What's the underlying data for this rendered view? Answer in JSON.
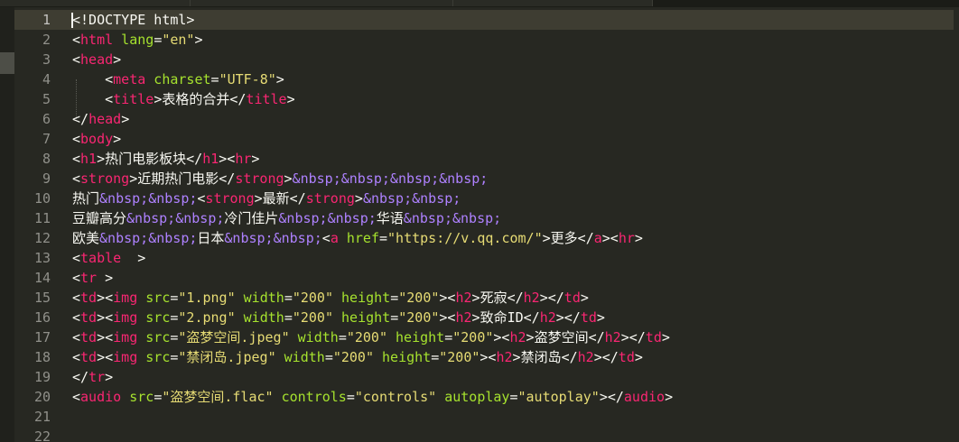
{
  "colors": {
    "background": "#272822",
    "tag": "#f92672",
    "attribute": "#a6e22e",
    "string": "#e6db74",
    "entity": "#ae81ff",
    "text": "#f8f8f2",
    "line_number": "#90908a",
    "current_line": "#3e3d32"
  },
  "editor": {
    "current_line": 1,
    "lines": [
      {
        "n": "1",
        "tokens": [
          [
            "t",
            "<!DOCTYPE html>"
          ]
        ]
      },
      {
        "n": "2",
        "tokens": [
          [
            "p",
            "<"
          ],
          [
            "g",
            "html"
          ],
          [
            "a",
            " lang"
          ],
          [
            "p",
            "="
          ],
          [
            "s",
            "\"en\""
          ],
          [
            "p",
            ">"
          ]
        ]
      },
      {
        "n": "3",
        "tokens": [
          [
            "p",
            "<"
          ],
          [
            "g",
            "head"
          ],
          [
            "p",
            ">"
          ]
        ]
      },
      {
        "n": "4",
        "tokens": [
          [
            "t",
            "    "
          ],
          [
            "p",
            "<"
          ],
          [
            "g",
            "meta"
          ],
          [
            "a",
            " charset"
          ],
          [
            "p",
            "="
          ],
          [
            "s",
            "\"UTF-8\""
          ],
          [
            "p",
            ">"
          ]
        ]
      },
      {
        "n": "5",
        "tokens": [
          [
            "t",
            "    "
          ],
          [
            "p",
            "<"
          ],
          [
            "g",
            "title"
          ],
          [
            "p",
            ">"
          ],
          [
            "t",
            "表格的合并"
          ],
          [
            "p",
            "</"
          ],
          [
            "g",
            "title"
          ],
          [
            "p",
            ">"
          ]
        ]
      },
      {
        "n": "6",
        "tokens": [
          [
            "p",
            "</"
          ],
          [
            "g",
            "head"
          ],
          [
            "p",
            ">"
          ]
        ]
      },
      {
        "n": "7",
        "tokens": [
          [
            "p",
            "<"
          ],
          [
            "g",
            "body"
          ],
          [
            "p",
            ">"
          ]
        ]
      },
      {
        "n": "8",
        "tokens": [
          [
            "p",
            "<"
          ],
          [
            "g",
            "h1"
          ],
          [
            "p",
            ">"
          ],
          [
            "t",
            "热门电影板块"
          ],
          [
            "p",
            "</"
          ],
          [
            "g",
            "h1"
          ],
          [
            "p",
            "><"
          ],
          [
            "g",
            "hr"
          ],
          [
            "p",
            ">"
          ]
        ]
      },
      {
        "n": "9",
        "tokens": [
          [
            "p",
            "<"
          ],
          [
            "g",
            "strong"
          ],
          [
            "p",
            ">"
          ],
          [
            "t",
            "近期热门电影"
          ],
          [
            "p",
            "</"
          ],
          [
            "g",
            "strong"
          ],
          [
            "p",
            ">"
          ],
          [
            "e",
            "&nbsp;&nbsp;&nbsp;&nbsp;"
          ]
        ]
      },
      {
        "n": "10",
        "tokens": [
          [
            "t",
            "热门"
          ],
          [
            "e",
            "&nbsp;&nbsp;"
          ],
          [
            "p",
            "<"
          ],
          [
            "g",
            "strong"
          ],
          [
            "p",
            ">"
          ],
          [
            "t",
            "最新"
          ],
          [
            "p",
            "</"
          ],
          [
            "g",
            "strong"
          ],
          [
            "p",
            ">"
          ],
          [
            "e",
            "&nbsp;&nbsp;"
          ]
        ]
      },
      {
        "n": "11",
        "tokens": [
          [
            "t",
            "豆瓣高分"
          ],
          [
            "e",
            "&nbsp;&nbsp;"
          ],
          [
            "t",
            "冷门佳片"
          ],
          [
            "e",
            "&nbsp;&nbsp;"
          ],
          [
            "t",
            "华语"
          ],
          [
            "e",
            "&nbsp;&nbsp;"
          ]
        ]
      },
      {
        "n": "12",
        "tokens": [
          [
            "t",
            "欧美"
          ],
          [
            "e",
            "&nbsp;&nbsp;"
          ],
          [
            "t",
            "日本"
          ],
          [
            "e",
            "&nbsp;&nbsp;"
          ],
          [
            "p",
            "<"
          ],
          [
            "g",
            "a"
          ],
          [
            "a",
            " href"
          ],
          [
            "p",
            "="
          ],
          [
            "s",
            "\"https://v.qq.com/\""
          ],
          [
            "p",
            ">"
          ],
          [
            "t",
            "更多"
          ],
          [
            "p",
            "</"
          ],
          [
            "g",
            "a"
          ],
          [
            "p",
            "><"
          ],
          [
            "g",
            "hr"
          ],
          [
            "p",
            ">"
          ]
        ]
      },
      {
        "n": "13",
        "tokens": [
          [
            "p",
            "<"
          ],
          [
            "g",
            "table"
          ],
          [
            "t",
            "  "
          ],
          [
            "p",
            ">"
          ]
        ]
      },
      {
        "n": "14",
        "tokens": [
          [
            "p",
            "<"
          ],
          [
            "g",
            "tr"
          ],
          [
            "t",
            " "
          ],
          [
            "p",
            ">"
          ]
        ]
      },
      {
        "n": "15",
        "tokens": [
          [
            "p",
            "<"
          ],
          [
            "g",
            "td"
          ],
          [
            "p",
            "><"
          ],
          [
            "g",
            "img"
          ],
          [
            "a",
            " src"
          ],
          [
            "p",
            "="
          ],
          [
            "s",
            "\"1.png\""
          ],
          [
            "a",
            " width"
          ],
          [
            "p",
            "="
          ],
          [
            "s",
            "\"200\""
          ],
          [
            "a",
            " height"
          ],
          [
            "p",
            "="
          ],
          [
            "s",
            "\"200\""
          ],
          [
            "p",
            "><"
          ],
          [
            "g",
            "h2"
          ],
          [
            "p",
            ">"
          ],
          [
            "t",
            "死寂"
          ],
          [
            "p",
            "</"
          ],
          [
            "g",
            "h2"
          ],
          [
            "p",
            "></"
          ],
          [
            "g",
            "td"
          ],
          [
            "p",
            ">"
          ]
        ]
      },
      {
        "n": "16",
        "tokens": [
          [
            "p",
            "<"
          ],
          [
            "g",
            "td"
          ],
          [
            "p",
            "><"
          ],
          [
            "g",
            "img"
          ],
          [
            "a",
            " src"
          ],
          [
            "p",
            "="
          ],
          [
            "s",
            "\"2.png\""
          ],
          [
            "a",
            " width"
          ],
          [
            "p",
            "="
          ],
          [
            "s",
            "\"200\""
          ],
          [
            "a",
            " height"
          ],
          [
            "p",
            "="
          ],
          [
            "s",
            "\"200\""
          ],
          [
            "p",
            "><"
          ],
          [
            "g",
            "h2"
          ],
          [
            "p",
            ">"
          ],
          [
            "t",
            "致命ID"
          ],
          [
            "p",
            "</"
          ],
          [
            "g",
            "h2"
          ],
          [
            "p",
            "></"
          ],
          [
            "g",
            "td"
          ],
          [
            "p",
            ">"
          ]
        ]
      },
      {
        "n": "17",
        "tokens": [
          [
            "p",
            "<"
          ],
          [
            "g",
            "td"
          ],
          [
            "p",
            "><"
          ],
          [
            "g",
            "img"
          ],
          [
            "a",
            " src"
          ],
          [
            "p",
            "="
          ],
          [
            "s",
            "\"盗梦空间.jpeg\""
          ],
          [
            "a",
            " width"
          ],
          [
            "p",
            "="
          ],
          [
            "s",
            "\"200\""
          ],
          [
            "a",
            " height"
          ],
          [
            "p",
            "="
          ],
          [
            "s",
            "\"200\""
          ],
          [
            "p",
            "><"
          ],
          [
            "g",
            "h2"
          ],
          [
            "p",
            ">"
          ],
          [
            "t",
            "盗梦空间"
          ],
          [
            "p",
            "</"
          ],
          [
            "g",
            "h2"
          ],
          [
            "p",
            "></"
          ],
          [
            "g",
            "td"
          ],
          [
            "p",
            ">"
          ]
        ]
      },
      {
        "n": "18",
        "tokens": [
          [
            "p",
            "<"
          ],
          [
            "g",
            "td"
          ],
          [
            "p",
            "><"
          ],
          [
            "g",
            "img"
          ],
          [
            "a",
            " src"
          ],
          [
            "p",
            "="
          ],
          [
            "s",
            "\"禁闭岛.jpeg\""
          ],
          [
            "a",
            " width"
          ],
          [
            "p",
            "="
          ],
          [
            "s",
            "\"200\""
          ],
          [
            "a",
            " height"
          ],
          [
            "p",
            "="
          ],
          [
            "s",
            "\"200\""
          ],
          [
            "p",
            "><"
          ],
          [
            "g",
            "h2"
          ],
          [
            "p",
            ">"
          ],
          [
            "t",
            "禁闭岛"
          ],
          [
            "p",
            "</"
          ],
          [
            "g",
            "h2"
          ],
          [
            "p",
            "></"
          ],
          [
            "g",
            "td"
          ],
          [
            "p",
            ">"
          ]
        ]
      },
      {
        "n": "19",
        "tokens": [
          [
            "p",
            "</"
          ],
          [
            "g",
            "tr"
          ],
          [
            "p",
            ">"
          ]
        ]
      },
      {
        "n": "20",
        "tokens": [
          [
            "p",
            "<"
          ],
          [
            "g",
            "audio"
          ],
          [
            "a",
            " src"
          ],
          [
            "p",
            "="
          ],
          [
            "s",
            "\"盗梦空间.flac\""
          ],
          [
            "a",
            " controls"
          ],
          [
            "p",
            "="
          ],
          [
            "s",
            "\"controls\""
          ],
          [
            "a",
            " autoplay"
          ],
          [
            "p",
            "="
          ],
          [
            "s",
            "\"autoplay\""
          ],
          [
            "p",
            "></"
          ],
          [
            "g",
            "audio"
          ],
          [
            "p",
            ">"
          ]
        ]
      },
      {
        "n": "21",
        "tokens": []
      },
      {
        "n": "22",
        "tokens": []
      }
    ]
  }
}
